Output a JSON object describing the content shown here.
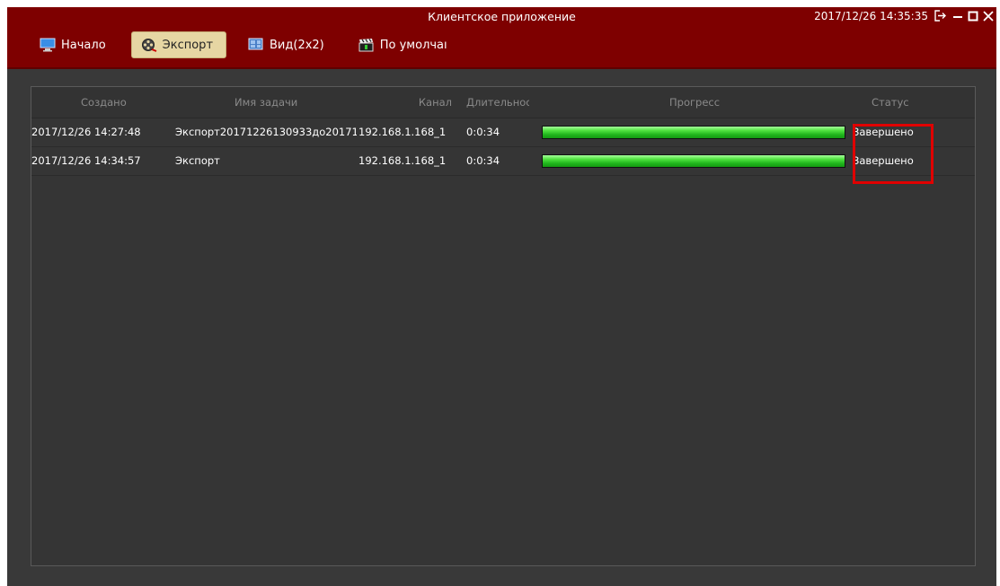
{
  "window": {
    "title": "Клиентское приложение",
    "clock": "2017/12/26 14:35:35",
    "controls": [
      "logout-icon",
      "minimize-icon",
      "maximize-icon",
      "close-icon"
    ]
  },
  "tabs": [
    {
      "label": "Начало",
      "icon": "monitor-icon",
      "active": false
    },
    {
      "label": "Экспорт",
      "icon": "film-reel-icon",
      "active": true
    },
    {
      "label": "Вид(2x2)",
      "icon": "view-grid-icon",
      "active": false
    },
    {
      "label": "По умолчаı",
      "icon": "clapperboard-icon",
      "active": false
    }
  ],
  "table": {
    "columns": [
      "Создано",
      "Имя задачи",
      "Канал",
      "Длительност",
      "Прогресс",
      "Статус"
    ],
    "rows": [
      {
        "created": "2017/12/26 14:27:48",
        "task_name": "Экспорт20171226130933до201712...",
        "channel": "192.168.1.168_1",
        "duration": "0:0:34",
        "progress": 1.0,
        "status": "Завершено"
      },
      {
        "created": "2017/12/26 14:34:57",
        "task_name": "Экспорт",
        "channel": "192.168.1.168_1",
        "duration": "0:0:34",
        "progress": 1.0,
        "status": "Завершено"
      }
    ]
  },
  "colors": {
    "titlebar": "#7e0000",
    "body": "#393939",
    "active_tab": "#e6d6a3",
    "progress_fill": "#2bc324",
    "highlight": "#e00000"
  }
}
